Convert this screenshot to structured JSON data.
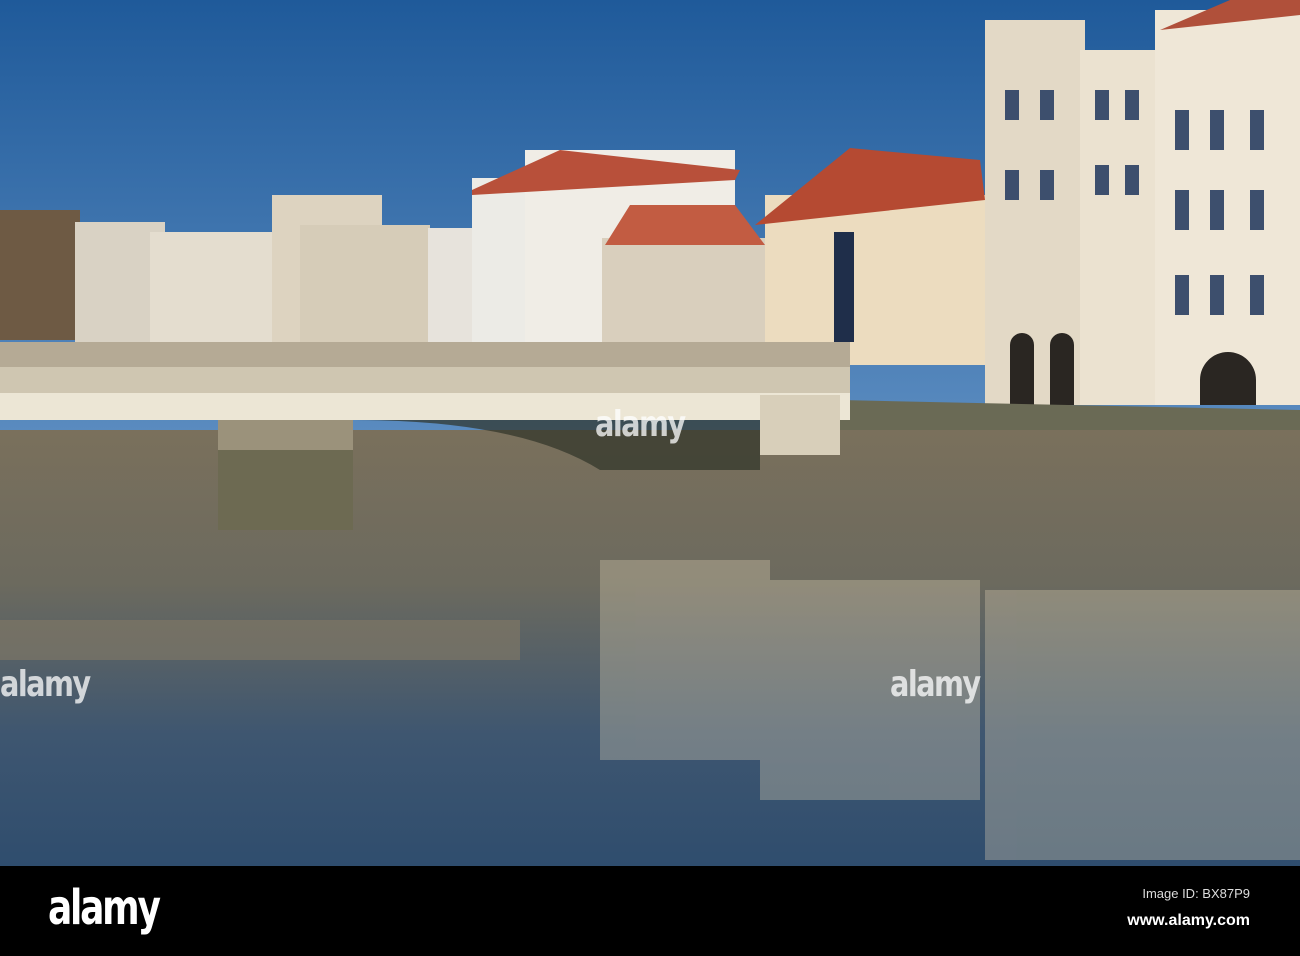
{
  "watermark": {
    "text": "alamy"
  },
  "footer": {
    "logo": "alamy",
    "image_id": "Image ID: BX87P9",
    "website": "www.alamy.com"
  },
  "colors": {
    "sky": "#2f6aa8",
    "water": "#3a4f63",
    "building": "#e8dfcf",
    "footer": "#000000"
  }
}
